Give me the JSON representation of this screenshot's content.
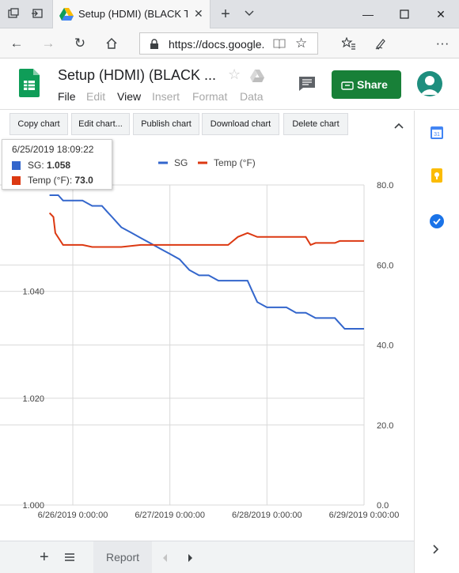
{
  "browser": {
    "tab_title": "Setup (HDMI) (BLACK TI",
    "url": "https://docs.google.c"
  },
  "doc": {
    "title": "Setup (HDMI) (BLACK ...",
    "menu": [
      "File",
      "Edit",
      "View",
      "Insert",
      "Format",
      "Data"
    ],
    "share_label": "Share"
  },
  "chart_toolbar": {
    "buttons": [
      "Copy chart",
      "Edit chart...",
      "Publish chart",
      "Download chart",
      "Delete chart"
    ]
  },
  "tooltip": {
    "timestamp": "6/25/2019 18:09:22",
    "sg_label": "SG",
    "sg_value": "1.058",
    "temp_label": "Temp (°F)",
    "temp_value": "73.0"
  },
  "sheet_bar": {
    "tab_label": "Report"
  },
  "colors": {
    "sg": "#3366cc",
    "temp": "#dc3912",
    "share": "#188038"
  },
  "chart_data": {
    "type": "line",
    "title": "",
    "legend_position": "top",
    "grid": true,
    "x": {
      "ticks": [
        "6/26/2019 0:00:00",
        "6/27/2019 0:00:00",
        "6/28/2019 0:00:00",
        "6/29/2019 0:00:00"
      ],
      "range_days": [
        -0.25,
        3.0
      ]
    },
    "y_left": {
      "ticks": [
        "1.000",
        "1.020",
        "1.040"
      ],
      "range": [
        1.0,
        1.058
      ]
    },
    "y_right": {
      "ticks": [
        "0.0",
        "20.0",
        "40.0",
        "60.0",
        "80.0"
      ],
      "range": [
        0,
        80
      ]
    },
    "series": [
      {
        "name": "SG",
        "axis": "left",
        "points": [
          [
            -0.24,
            1.058
          ],
          [
            -0.15,
            1.058
          ],
          [
            -0.1,
            1.057
          ],
          [
            0.0,
            1.057
          ],
          [
            0.1,
            1.057
          ],
          [
            0.2,
            1.056
          ],
          [
            0.3,
            1.056
          ],
          [
            0.35,
            1.055
          ],
          [
            0.4,
            1.054
          ],
          [
            0.45,
            1.053
          ],
          [
            0.5,
            1.052
          ],
          [
            0.6,
            1.051
          ],
          [
            0.7,
            1.05
          ],
          [
            0.8,
            1.049
          ],
          [
            0.9,
            1.048
          ],
          [
            1.0,
            1.047
          ],
          [
            1.1,
            1.046
          ],
          [
            1.2,
            1.044
          ],
          [
            1.3,
            1.043
          ],
          [
            1.4,
            1.043
          ],
          [
            1.5,
            1.042
          ],
          [
            1.6,
            1.042
          ],
          [
            1.7,
            1.042
          ],
          [
            1.8,
            1.042
          ],
          [
            1.85,
            1.04
          ],
          [
            1.9,
            1.038
          ],
          [
            2.0,
            1.037
          ],
          [
            2.1,
            1.037
          ],
          [
            2.2,
            1.037
          ],
          [
            2.3,
            1.036
          ],
          [
            2.4,
            1.036
          ],
          [
            2.5,
            1.035
          ],
          [
            2.6,
            1.035
          ],
          [
            2.7,
            1.035
          ],
          [
            2.75,
            1.034
          ],
          [
            2.8,
            1.033
          ],
          [
            2.9,
            1.033
          ],
          [
            3.0,
            1.033
          ]
        ]
      },
      {
        "name": "Temp (°F)",
        "axis": "right",
        "points": [
          [
            -0.24,
            73.0
          ],
          [
            -0.2,
            72.0
          ],
          [
            -0.18,
            68.0
          ],
          [
            -0.1,
            65.0
          ],
          [
            0.0,
            65.0
          ],
          [
            0.1,
            65.0
          ],
          [
            0.2,
            64.5
          ],
          [
            0.3,
            64.5
          ],
          [
            0.5,
            64.5
          ],
          [
            0.7,
            65.0
          ],
          [
            1.0,
            65.0
          ],
          [
            1.3,
            65.0
          ],
          [
            1.6,
            65.0
          ],
          [
            1.65,
            66.0
          ],
          [
            1.7,
            67.0
          ],
          [
            1.8,
            68.0
          ],
          [
            1.9,
            67.0
          ],
          [
            2.0,
            67.0
          ],
          [
            2.2,
            67.0
          ],
          [
            2.4,
            67.0
          ],
          [
            2.45,
            65.0
          ],
          [
            2.5,
            65.5
          ],
          [
            2.7,
            65.5
          ],
          [
            2.75,
            66.0
          ],
          [
            3.0,
            66.0
          ]
        ]
      }
    ]
  }
}
